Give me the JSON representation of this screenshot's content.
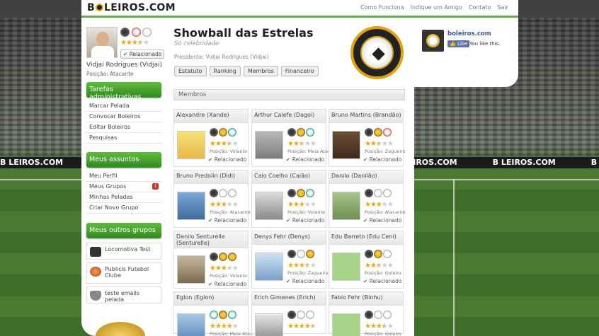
{
  "brand": {
    "logo_pre": "B",
    "logo_post": "LEIROS.COM",
    "accent": "#6aa84f"
  },
  "top_nav": [
    "Como Funciona",
    "Indique um Amigo",
    "Contato",
    "Sair"
  ],
  "banner_text": "B  LEIROS.COM",
  "user": {
    "name": "Vidjai Rodrigues (Vidjai)",
    "position": "Posição: Atacante",
    "stars": 3.5,
    "relation": "Relacionado"
  },
  "sidebar": {
    "admin_title": "Tarefas administrativas",
    "admin_items": [
      "Marcar Pelada",
      "Convocar Boleiros",
      "Editar Boleiros",
      "Pesquisas"
    ],
    "mine_title": "Meus assuntos",
    "mine_items": [
      "Meu Perfil",
      "Meus Grupos",
      "Minhas Peladas",
      "Criar Novo Grupo"
    ],
    "notif_count": "1",
    "groups_title": "Meus outros grupos",
    "groups": [
      "Locomotiva Test",
      "Publicis Futebol Clube",
      "teste emails pelada"
    ]
  },
  "group": {
    "title": "Showball das Estrelas",
    "subtitle": "Só celebridade",
    "president": "Presidente: Vidjai Rodrigues (Vidjai)",
    "tabs": [
      "Estatuto",
      "Ranking",
      "Membros",
      "Financeiro"
    ]
  },
  "members_header": "Membros",
  "members": [
    {
      "name": "Alexandre (Xande)",
      "pos": "Posição: Volante",
      "stars": 3.5,
      "rel": "Relacionado"
    },
    {
      "name": "Arthur Calefe (Dagol)",
      "pos": "Posição: Meia Atac.",
      "stars": 2.5,
      "rel": "Relacionado"
    },
    {
      "name": "Bruno Martins (Brandão)",
      "pos": "Posição: Zagueiro",
      "stars": 2.5,
      "rel": "Relacionado"
    },
    {
      "name": "Bruno Predolin (Didi)",
      "pos": "Posição: Atacante",
      "stars": 3,
      "rel": "Relacionado"
    },
    {
      "name": "Caio Coelho (Caião)",
      "pos": "Posição: Volante",
      "stars": 3,
      "rel": "Relacionado"
    },
    {
      "name": "Danilo (Danilão)",
      "pos": "Posição: Atacante",
      "stars": 3,
      "rel": "Relacionado"
    },
    {
      "name": "Danilo Senturelle (Senturelle)",
      "pos": "Posição: Volante",
      "stars": 3,
      "rel": "Relacionado"
    },
    {
      "name": "Denys Fehr (Denys)",
      "pos": "Posição: Zagueiro",
      "stars": 3.5,
      "rel": "Relacionado"
    },
    {
      "name": "Edu Barreto (Edu Ceni)",
      "pos": "Posição: Goleiro",
      "stars": 2.5,
      "rel": "Relacionado"
    },
    {
      "name": "Eglon (Eglon)",
      "pos": "Posição: Meia Atac.",
      "stars": 4,
      "rel": ""
    },
    {
      "name": "Erich Gimenes (Erich)",
      "pos": "",
      "stars": 4.5,
      "rel": ""
    },
    {
      "name": "Fabio Fehr (Binhu)",
      "pos": "Posição: Goleiro",
      "stars": 3.5,
      "rel": ""
    }
  ],
  "facebook": {
    "name": "boleiros.com",
    "like": "Like",
    "text": "You like this."
  }
}
